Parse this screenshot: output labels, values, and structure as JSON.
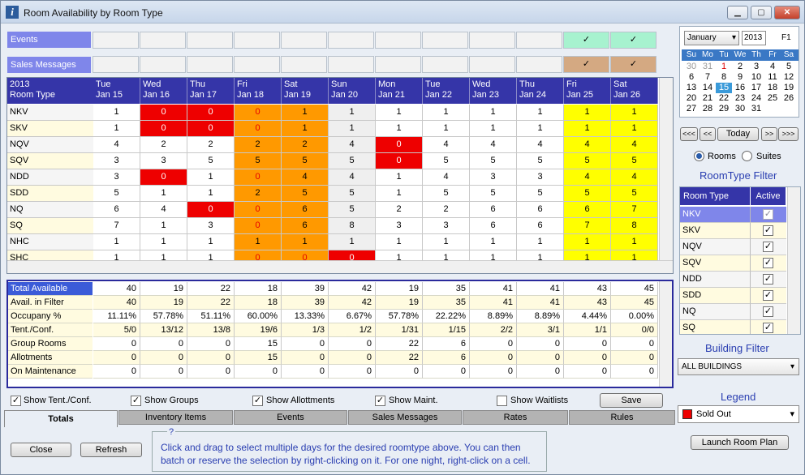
{
  "window": {
    "title": "Room Availability by Room Type",
    "min": "▁",
    "max": "▢",
    "close": "✕"
  },
  "events_label": "Events",
  "sales_label": "Sales Messages",
  "check": "✓",
  "grid": {
    "year": "2013",
    "roomtype_hdr": "Room Type",
    "days": [
      {
        "dow": "Tue",
        "date": "Jan 15"
      },
      {
        "dow": "Wed",
        "date": "Jan 16"
      },
      {
        "dow": "Thu",
        "date": "Jan 17"
      },
      {
        "dow": "Fri",
        "date": "Jan 18"
      },
      {
        "dow": "Sat",
        "date": "Jan 19"
      },
      {
        "dow": "Sun",
        "date": "Jan 20"
      },
      {
        "dow": "Mon",
        "date": "Jan 21"
      },
      {
        "dow": "Tue",
        "date": "Jan 22"
      },
      {
        "dow": "Wed",
        "date": "Jan 23"
      },
      {
        "dow": "Thu",
        "date": "Jan 24"
      },
      {
        "dow": "Fri",
        "date": "Jan 25"
      },
      {
        "dow": "Sat",
        "date": "Jan 26"
      }
    ],
    "rows": [
      {
        "name": "NKV",
        "v": [
          "1",
          "0",
          "0",
          "0",
          "1",
          "1",
          "1",
          "1",
          "1",
          "1",
          "1",
          "1"
        ]
      },
      {
        "name": "SKV",
        "v": [
          "1",
          "0",
          "0",
          "0",
          "1",
          "1",
          "1",
          "1",
          "1",
          "1",
          "1",
          "1"
        ]
      },
      {
        "name": "NQV",
        "v": [
          "4",
          "2",
          "2",
          "2",
          "2",
          "4",
          "0",
          "4",
          "4",
          "4",
          "4",
          "4"
        ]
      },
      {
        "name": "SQV",
        "v": [
          "3",
          "3",
          "5",
          "5",
          "5",
          "5",
          "0",
          "5",
          "5",
          "5",
          "5",
          "5"
        ]
      },
      {
        "name": "NDD",
        "v": [
          "3",
          "0",
          "1",
          "0",
          "4",
          "4",
          "1",
          "4",
          "3",
          "3",
          "4",
          "4"
        ]
      },
      {
        "name": "SDD",
        "v": [
          "5",
          "1",
          "1",
          "2",
          "5",
          "5",
          "1",
          "5",
          "5",
          "5",
          "5",
          "5"
        ]
      },
      {
        "name": "NQ",
        "v": [
          "6",
          "4",
          "0",
          "0",
          "6",
          "5",
          "2",
          "2",
          "6",
          "6",
          "6",
          "7"
        ]
      },
      {
        "name": "SQ",
        "v": [
          "7",
          "1",
          "3",
          "0",
          "6",
          "8",
          "3",
          "3",
          "6",
          "6",
          "7",
          "8"
        ]
      },
      {
        "name": "NHC",
        "v": [
          "1",
          "1",
          "1",
          "1",
          "1",
          "1",
          "1",
          "1",
          "1",
          "1",
          "1",
          "1"
        ]
      },
      {
        "name": "SHC",
        "v": [
          "1",
          "1",
          "1",
          "0",
          "0",
          "0",
          "1",
          "1",
          "1",
          "1",
          "1",
          "1"
        ]
      }
    ]
  },
  "totals": {
    "rows": [
      {
        "label": "Total Available",
        "v": [
          "40",
          "19",
          "22",
          "18",
          "39",
          "42",
          "19",
          "35",
          "41",
          "41",
          "43",
          "45"
        ]
      },
      {
        "label": "Avail. in Filter",
        "v": [
          "40",
          "19",
          "22",
          "18",
          "39",
          "42",
          "19",
          "35",
          "41",
          "41",
          "43",
          "45"
        ]
      },
      {
        "label": "Occupany %",
        "v": [
          "11.11%",
          "57.78%",
          "51.11%",
          "60.00%",
          "13.33%",
          "6.67%",
          "57.78%",
          "22.22%",
          "8.89%",
          "8.89%",
          "4.44%",
          "0.00%"
        ]
      },
      {
        "label": "Tent./Conf.",
        "v": [
          "5/0",
          "13/12",
          "13/8",
          "19/6",
          "1/3",
          "1/2",
          "1/31",
          "1/15",
          "2/2",
          "3/1",
          "1/1",
          "0/0"
        ]
      },
      {
        "label": "Group Rooms",
        "v": [
          "0",
          "0",
          "0",
          "15",
          "0",
          "0",
          "22",
          "6",
          "0",
          "0",
          "0",
          "0"
        ]
      },
      {
        "label": "Allotments",
        "v": [
          "0",
          "0",
          "0",
          "15",
          "0",
          "0",
          "22",
          "6",
          "0",
          "0",
          "0",
          "0"
        ]
      },
      {
        "label": "On Maintenance",
        "v": [
          "0",
          "0",
          "0",
          "0",
          "0",
          "0",
          "0",
          "0",
          "0",
          "0",
          "0",
          "0"
        ]
      }
    ]
  },
  "checks": {
    "tent": "Show Tent./Conf.",
    "groups": "Show Groups",
    "allot": "Show Allottments",
    "maint": "Show Maint.",
    "waitlists": "Show Waitlists",
    "save": "Save"
  },
  "tabs": [
    "Totals",
    "Inventory Items",
    "Events",
    "Sales Messages",
    "Rates",
    "Rules"
  ],
  "buttons": {
    "close": "Close",
    "refresh": "Refresh",
    "launch": "Launch Room Plan"
  },
  "help": {
    "icon": "?",
    "text": "Click and drag to select multiple days for the desired roomtype above. You can then batch or reserve the selection by right-clicking on it.  For one night, right-click on a cell."
  },
  "calendar": {
    "month": "January",
    "year": "2013",
    "f1": "F1",
    "dows": [
      "Su",
      "Mo",
      "Tu",
      "We",
      "Th",
      "Fr",
      "Sa"
    ],
    "weeks": [
      [
        "30",
        "31",
        "1",
        "2",
        "3",
        "4",
        "5"
      ],
      [
        "6",
        "7",
        "8",
        "9",
        "10",
        "11",
        "12"
      ],
      [
        "13",
        "14",
        "15",
        "16",
        "17",
        "18",
        "19"
      ],
      [
        "20",
        "21",
        "22",
        "23",
        "24",
        "25",
        "26"
      ],
      [
        "27",
        "28",
        "29",
        "30",
        "31",
        "",
        ""
      ]
    ],
    "nav": [
      "<<<",
      "<<",
      "Today",
      ">>",
      ">>>"
    ]
  },
  "radio": {
    "rooms": "Rooms",
    "suites": "Suites"
  },
  "filter": {
    "title": "RoomType Filter",
    "col1": "Room Type",
    "col2": "Active",
    "items": [
      "NKV",
      "SKV",
      "NQV",
      "SQV",
      "NDD",
      "SDD",
      "NQ",
      "SQ"
    ]
  },
  "building": {
    "title": "Building Filter",
    "value": "ALL BUILDINGS"
  },
  "legend": {
    "title": "Legend",
    "value": "Sold Out"
  },
  "colors": {
    "red": "#ee0000",
    "orange": "#ff9900",
    "yellow": "#ffff00",
    "green": "#a7f2cf",
    "tan": "#d4a982",
    "header": "#3535a8",
    "accent": "#2a3eb1"
  }
}
